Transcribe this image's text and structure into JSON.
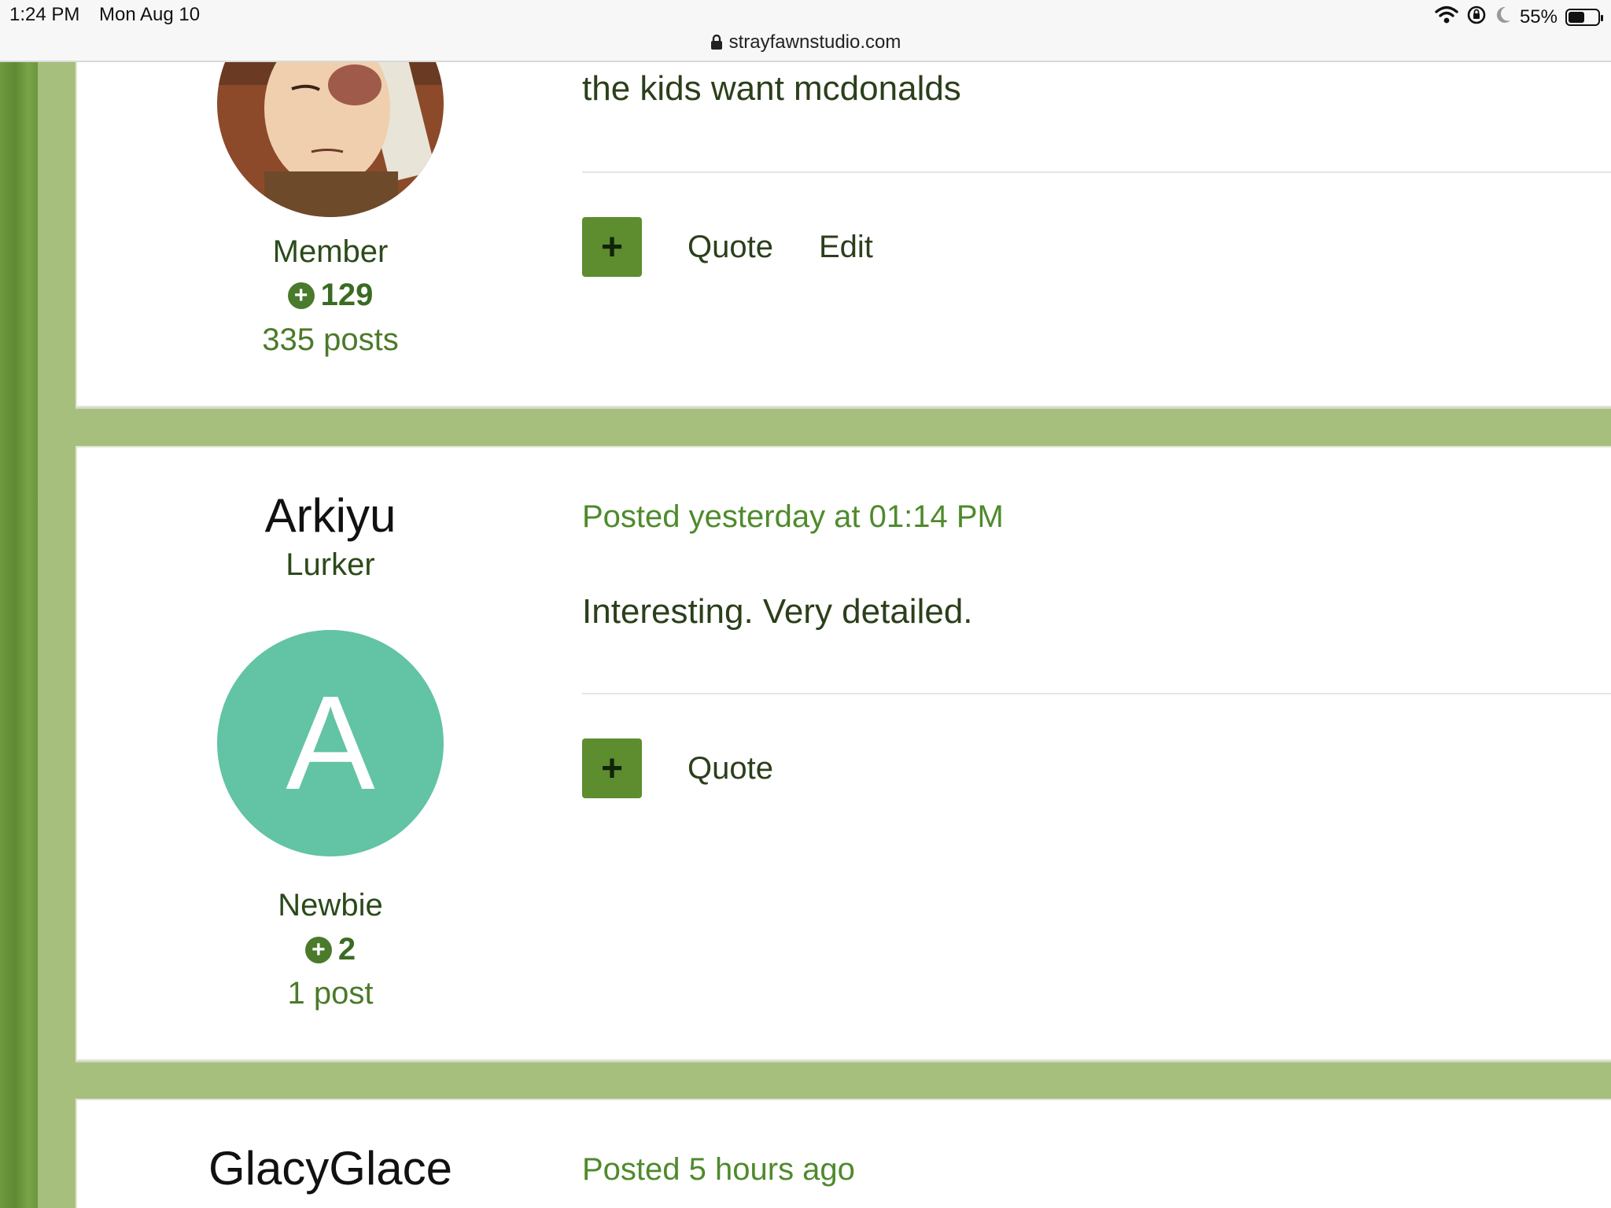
{
  "status_bar": {
    "time": "1:24 PM",
    "date": "Mon Aug 10",
    "battery": "55%",
    "battery_level": 0.55,
    "icons": [
      "wifi-icon",
      "orientation-lock-icon",
      "moon-icon",
      "battery-icon"
    ]
  },
  "browser": {
    "url": "strayfawnstudio.com",
    "lock_icon": "lock-icon"
  },
  "colors": {
    "page_bg": "#a7bf7d",
    "accent_green": "#5d8d2e",
    "link_green": "#4f8a2c",
    "avatar_teal": "#62c3a5"
  },
  "posts": [
    {
      "rank": "Member",
      "reputation": "129",
      "post_count": "335 posts",
      "body": "the kids want mcdonalds",
      "actions": {
        "rep_symbol": "+",
        "quote": "Quote",
        "edit": "Edit"
      }
    },
    {
      "author": "Arkiyu",
      "title": "Lurker",
      "avatar_letter": "A",
      "rank": "Newbie",
      "reputation": "2",
      "post_count": "1 post",
      "posted": "Posted yesterday at 01:14 PM",
      "body": "Interesting. Very detailed.",
      "actions": {
        "rep_symbol": "+",
        "quote": "Quote"
      }
    },
    {
      "author": "GlacyGlace",
      "posted": "Posted 5 hours ago"
    }
  ]
}
